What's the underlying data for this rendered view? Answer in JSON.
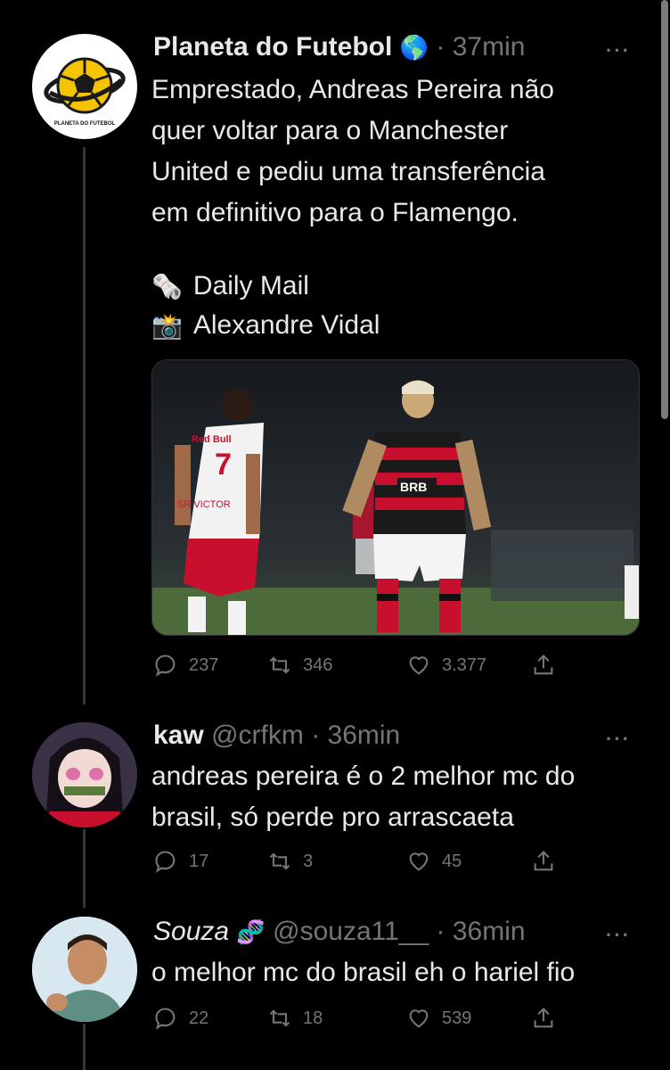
{
  "tweets": [
    {
      "name": "Planeta do Futebol",
      "badge": "🌎",
      "handle": "",
      "time": "· 37min",
      "text_lines": [
        "Emprestado, Andreas Pereira não",
        "quer voltar para o Manchester",
        "United e pediu uma transferência",
        "em definitivo para o Flamengo."
      ],
      "credits": [
        {
          "emoji": "🗞️",
          "text": "Daily Mail"
        },
        {
          "emoji": "📸",
          "text": "Alexandre Vidal"
        }
      ],
      "avatar_text": "PLANETA DO FUTEBOL",
      "image_text": {
        "sponsor": "BRB",
        "shirt_number": "7",
        "shirt_name": "SR VICTOR",
        "shirt_brand": "Red Bull"
      },
      "stats": {
        "replies": "237",
        "retweets": "346",
        "likes": "3.377"
      }
    },
    {
      "name": "kaw",
      "handle": "@crfkm",
      "time": "· 36min",
      "text_lines": [
        "andreas pereira é o 2 melhor mc do",
        "brasil, só perde pro arrascaeta"
      ],
      "stats": {
        "replies": "17",
        "retweets": "3",
        "likes": "45"
      }
    },
    {
      "name": "Souza",
      "badge": "🧬",
      "handle": "@souza11__",
      "time": "· 36min",
      "text_lines": [
        "o melhor mc do brasil eh o hariel fio"
      ],
      "stats": {
        "replies": "22",
        "retweets": "18",
        "likes": "539"
      }
    }
  ],
  "more_label": "···",
  "colors": {
    "background": "#000000",
    "text": "#e7e9ea",
    "muted": "#71767b",
    "flamengo_red": "#c8102e"
  },
  "icons": [
    "reply-icon",
    "retweet-icon",
    "like-icon",
    "share-icon",
    "more-icon"
  ]
}
